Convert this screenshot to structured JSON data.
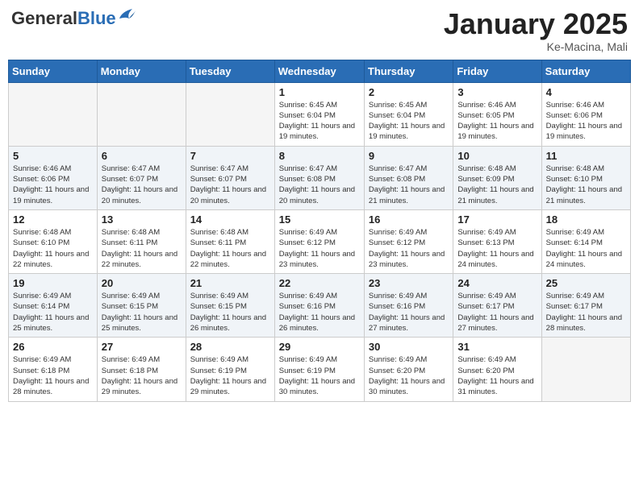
{
  "header": {
    "logo_general": "General",
    "logo_blue": "Blue",
    "month_year": "January 2025",
    "location": "Ke-Macina, Mali"
  },
  "weekdays": [
    "Sunday",
    "Monday",
    "Tuesday",
    "Wednesday",
    "Thursday",
    "Friday",
    "Saturday"
  ],
  "weeks": [
    [
      {
        "day": "",
        "info": ""
      },
      {
        "day": "",
        "info": ""
      },
      {
        "day": "",
        "info": ""
      },
      {
        "day": "1",
        "info": "Sunrise: 6:45 AM\nSunset: 6:04 PM\nDaylight: 11 hours and 19 minutes."
      },
      {
        "day": "2",
        "info": "Sunrise: 6:45 AM\nSunset: 6:04 PM\nDaylight: 11 hours and 19 minutes."
      },
      {
        "day": "3",
        "info": "Sunrise: 6:46 AM\nSunset: 6:05 PM\nDaylight: 11 hours and 19 minutes."
      },
      {
        "day": "4",
        "info": "Sunrise: 6:46 AM\nSunset: 6:06 PM\nDaylight: 11 hours and 19 minutes."
      }
    ],
    [
      {
        "day": "5",
        "info": "Sunrise: 6:46 AM\nSunset: 6:06 PM\nDaylight: 11 hours and 19 minutes."
      },
      {
        "day": "6",
        "info": "Sunrise: 6:47 AM\nSunset: 6:07 PM\nDaylight: 11 hours and 20 minutes."
      },
      {
        "day": "7",
        "info": "Sunrise: 6:47 AM\nSunset: 6:07 PM\nDaylight: 11 hours and 20 minutes."
      },
      {
        "day": "8",
        "info": "Sunrise: 6:47 AM\nSunset: 6:08 PM\nDaylight: 11 hours and 20 minutes."
      },
      {
        "day": "9",
        "info": "Sunrise: 6:47 AM\nSunset: 6:08 PM\nDaylight: 11 hours and 21 minutes."
      },
      {
        "day": "10",
        "info": "Sunrise: 6:48 AM\nSunset: 6:09 PM\nDaylight: 11 hours and 21 minutes."
      },
      {
        "day": "11",
        "info": "Sunrise: 6:48 AM\nSunset: 6:10 PM\nDaylight: 11 hours and 21 minutes."
      }
    ],
    [
      {
        "day": "12",
        "info": "Sunrise: 6:48 AM\nSunset: 6:10 PM\nDaylight: 11 hours and 22 minutes."
      },
      {
        "day": "13",
        "info": "Sunrise: 6:48 AM\nSunset: 6:11 PM\nDaylight: 11 hours and 22 minutes."
      },
      {
        "day": "14",
        "info": "Sunrise: 6:48 AM\nSunset: 6:11 PM\nDaylight: 11 hours and 22 minutes."
      },
      {
        "day": "15",
        "info": "Sunrise: 6:49 AM\nSunset: 6:12 PM\nDaylight: 11 hours and 23 minutes."
      },
      {
        "day": "16",
        "info": "Sunrise: 6:49 AM\nSunset: 6:12 PM\nDaylight: 11 hours and 23 minutes."
      },
      {
        "day": "17",
        "info": "Sunrise: 6:49 AM\nSunset: 6:13 PM\nDaylight: 11 hours and 24 minutes."
      },
      {
        "day": "18",
        "info": "Sunrise: 6:49 AM\nSunset: 6:14 PM\nDaylight: 11 hours and 24 minutes."
      }
    ],
    [
      {
        "day": "19",
        "info": "Sunrise: 6:49 AM\nSunset: 6:14 PM\nDaylight: 11 hours and 25 minutes."
      },
      {
        "day": "20",
        "info": "Sunrise: 6:49 AM\nSunset: 6:15 PM\nDaylight: 11 hours and 25 minutes."
      },
      {
        "day": "21",
        "info": "Sunrise: 6:49 AM\nSunset: 6:15 PM\nDaylight: 11 hours and 26 minutes."
      },
      {
        "day": "22",
        "info": "Sunrise: 6:49 AM\nSunset: 6:16 PM\nDaylight: 11 hours and 26 minutes."
      },
      {
        "day": "23",
        "info": "Sunrise: 6:49 AM\nSunset: 6:16 PM\nDaylight: 11 hours and 27 minutes."
      },
      {
        "day": "24",
        "info": "Sunrise: 6:49 AM\nSunset: 6:17 PM\nDaylight: 11 hours and 27 minutes."
      },
      {
        "day": "25",
        "info": "Sunrise: 6:49 AM\nSunset: 6:17 PM\nDaylight: 11 hours and 28 minutes."
      }
    ],
    [
      {
        "day": "26",
        "info": "Sunrise: 6:49 AM\nSunset: 6:18 PM\nDaylight: 11 hours and 28 minutes."
      },
      {
        "day": "27",
        "info": "Sunrise: 6:49 AM\nSunset: 6:18 PM\nDaylight: 11 hours and 29 minutes."
      },
      {
        "day": "28",
        "info": "Sunrise: 6:49 AM\nSunset: 6:19 PM\nDaylight: 11 hours and 29 minutes."
      },
      {
        "day": "29",
        "info": "Sunrise: 6:49 AM\nSunset: 6:19 PM\nDaylight: 11 hours and 30 minutes."
      },
      {
        "day": "30",
        "info": "Sunrise: 6:49 AM\nSunset: 6:20 PM\nDaylight: 11 hours and 30 minutes."
      },
      {
        "day": "31",
        "info": "Sunrise: 6:49 AM\nSunset: 6:20 PM\nDaylight: 11 hours and 31 minutes."
      },
      {
        "day": "",
        "info": ""
      }
    ]
  ]
}
